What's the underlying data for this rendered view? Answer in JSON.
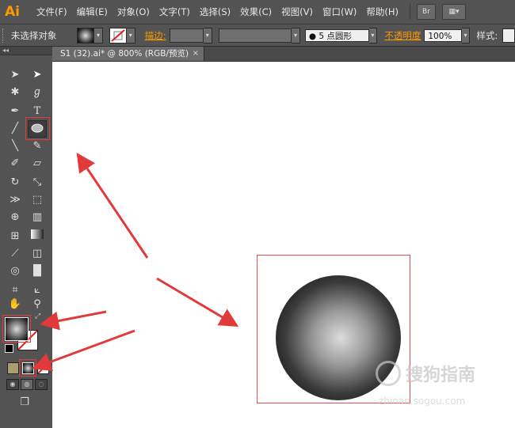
{
  "app": {
    "logo": "Ai"
  },
  "menu": [
    "文件(F)",
    "编辑(E)",
    "对象(O)",
    "文字(T)",
    "选择(S)",
    "效果(C)",
    "视图(V)",
    "窗口(W)",
    "帮助(H)"
  ],
  "menubar_buttons": {
    "bridge": "Br"
  },
  "control": {
    "selection": "未选择对象",
    "stroke_label": "描边:",
    "brush": "5 点圆形",
    "opacity_label": "不透明度",
    "opacity_value": "100%",
    "style_label": "样式:"
  },
  "document": {
    "tab_title": "S1 (32).ai* @ 800% (RGB/预览)",
    "close": "×"
  },
  "tools_panel": {
    "collapse": "◂◂"
  },
  "watermark": {
    "text": "搜狗指南",
    "sub": "zhinan.sogou.com"
  },
  "colors": {
    "panel": "#535353",
    "accent": "#ff9a00",
    "highlight": "#e23a3a"
  },
  "icons": [
    "selection-tool-icon",
    "direct-selection-tool-icon",
    "magic-wand-icon",
    "lasso-icon",
    "pen-tool-icon",
    "type-tool-icon",
    "line-tool-icon",
    "ellipse-tool-icon",
    "paintbrush-icon",
    "pencil-icon",
    "blob-brush-icon",
    "eraser-icon",
    "rotate-tool-icon",
    "scale-tool-icon",
    "width-tool-icon",
    "free-transform-icon",
    "shape-builder-icon",
    "perspective-grid-icon",
    "mesh-tool-icon",
    "gradient-tool-icon",
    "eyedropper-icon",
    "blend-tool-icon",
    "symbol-sprayer-icon",
    "column-graph-icon",
    "artboard-tool-icon",
    "slice-tool-icon",
    "hand-tool-icon",
    "zoom-tool-icon"
  ]
}
